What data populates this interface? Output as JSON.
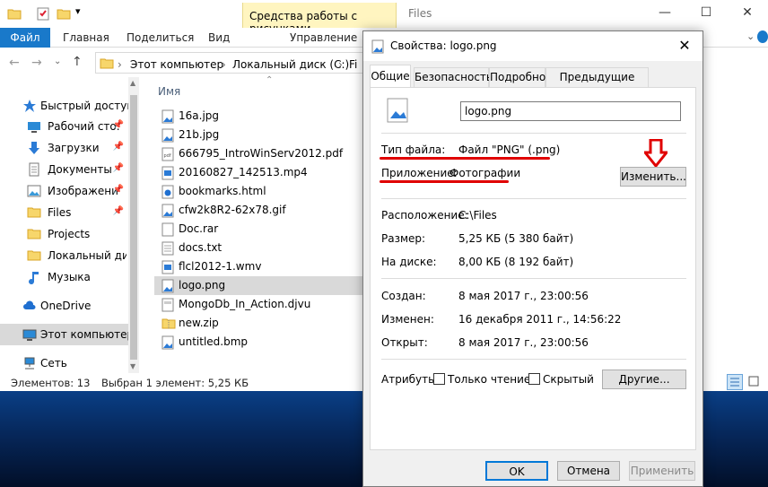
{
  "explorer": {
    "context_tab": "Средства работы с рисунками",
    "title": "Files",
    "window_buttons": [
      "—",
      "☐",
      "✕"
    ],
    "ribbon_tabs": [
      "Файл",
      "Главная",
      "Поделиться",
      "Вид",
      "Управление"
    ],
    "breadcrumb": [
      "Этот компьютер",
      "Локальный диск (C:)",
      "Fi"
    ],
    "nav": {
      "quick_access": "Быстрый доступ",
      "items": [
        {
          "label": "Рабочий сто.",
          "pinned": true
        },
        {
          "label": "Загрузки",
          "pinned": true
        },
        {
          "label": "Документы",
          "pinned": true
        },
        {
          "label": "Изображени",
          "pinned": true
        },
        {
          "label": "Files",
          "pinned": true
        },
        {
          "label": "Projects",
          "pinned": false
        },
        {
          "label": "Локальный дис",
          "pinned": false
        },
        {
          "label": "Музыка",
          "pinned": false
        }
      ],
      "onedrive": "OneDrive",
      "this_pc": "Этот компьютер",
      "network": "Сеть"
    },
    "column_header": "Имя",
    "files": [
      {
        "name": "16a.jpg",
        "icon": "image-file-icon"
      },
      {
        "name": "21b.jpg",
        "icon": "image-file-icon"
      },
      {
        "name": "666795_IntroWinServ2012.pdf",
        "icon": "pdf-file-icon"
      },
      {
        "name": "20160827_142513.mp4",
        "icon": "video-file-icon"
      },
      {
        "name": "bookmarks.html",
        "icon": "html-file-icon"
      },
      {
        "name": "cfw2k8R2-62x78.gif",
        "icon": "image-file-icon"
      },
      {
        "name": "Doc.rar",
        "icon": "archive-file-icon"
      },
      {
        "name": "docs.txt",
        "icon": "text-file-icon"
      },
      {
        "name": "flcl2012-1.wmv",
        "icon": "video-file-icon"
      },
      {
        "name": "logo.png",
        "icon": "image-file-icon"
      },
      {
        "name": "MongoDb_In_Action.djvu",
        "icon": "djvu-file-icon"
      },
      {
        "name": "new.zip",
        "icon": "zip-folder-icon"
      },
      {
        "name": "untitled.bmp",
        "icon": "image-file-icon"
      }
    ],
    "selected_file": "logo.png",
    "status": {
      "count": "Элементов: 13",
      "selection": "Выбран 1 элемент: 5,25 КБ"
    }
  },
  "dialog": {
    "title": "Свойства: logo.png",
    "close": "✕",
    "tabs": [
      "Общие",
      "Безопасность",
      "Подробно",
      "Предыдущие версии"
    ],
    "active_tab": "Общие",
    "filename": "logo.png",
    "file_type_label": "Тип файла:",
    "file_type_value": "Файл \"PNG\" (.png)",
    "app_label": "Приложение:",
    "app_value": "Фотографии",
    "change_button": "Изменить...",
    "location_label": "Расположение:",
    "location_value": "C:\\Files",
    "size_label": "Размер:",
    "size_value": "5,25 КБ (5 380 байт)",
    "disk_label": "На диске:",
    "disk_value": "8,00 КБ (8 192 байт)",
    "created_label": "Создан:",
    "created_value": "8 мая 2017 г., 23:00:56",
    "modified_label": "Изменен:",
    "modified_value": "16 декабря 2011 г., 14:56:22",
    "opened_label": "Открыт:",
    "opened_value": "8 мая 2017 г., 23:00:56",
    "attributes_label": "Атрибуты:",
    "readonly_label": "Только чтение",
    "readonly_checked": false,
    "hidden_label": "Скрытый",
    "hidden_checked": false,
    "other_button": "Другие...",
    "ok_button": "OK",
    "cancel_button": "Отмена",
    "apply_button": "Применить"
  },
  "colors": {
    "file_tab": "#1979ca",
    "context_tab": "#fff5c0",
    "annotation_red": "#e00000",
    "selection": "#d9d9d9"
  }
}
